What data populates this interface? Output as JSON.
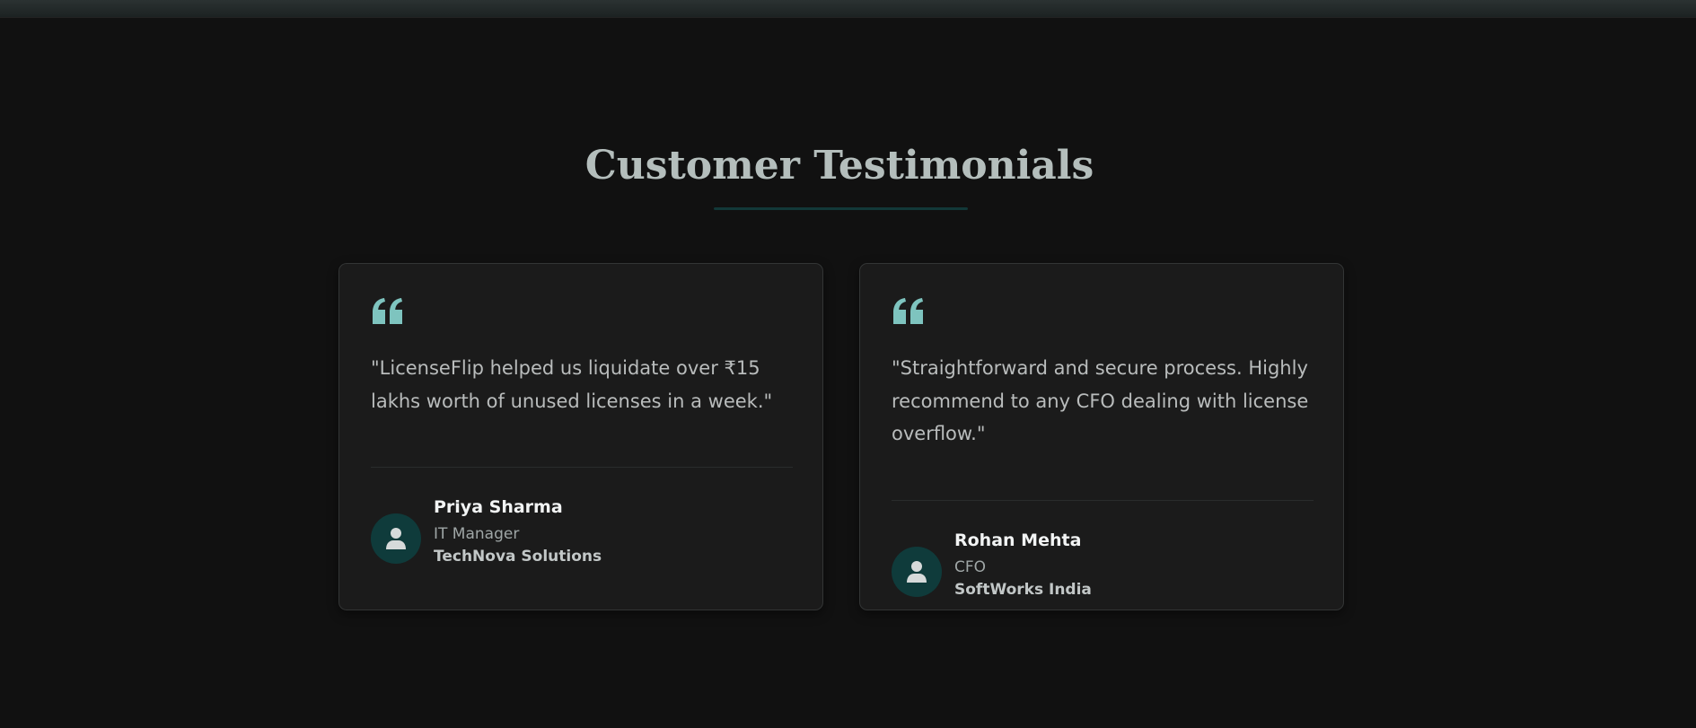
{
  "section": {
    "title": "Customer Testimonials"
  },
  "colors": {
    "background": "#111111",
    "card_background": "#1b1b1b",
    "accent": "#7ec4bf",
    "avatar_background": "#0f3b3b",
    "title_text": "#b4bebc"
  },
  "testimonials": [
    {
      "icon": "quote-left-icon",
      "quote": "\"LicenseFlip helped us liquidate over ₹15 lakhs worth of unused licenses in a week.\"",
      "author": {
        "avatar_icon": "user-icon",
        "name": "Priya Sharma",
        "role": "IT Manager",
        "company": "TechNova Solutions"
      }
    },
    {
      "icon": "quote-left-icon",
      "quote": "\"Straightforward and secure process. Highly recommend to any CFO dealing with license overflow.\"",
      "author": {
        "avatar_icon": "user-icon",
        "name": "Rohan Mehta",
        "role": "CFO",
        "company": "SoftWorks India"
      }
    }
  ]
}
